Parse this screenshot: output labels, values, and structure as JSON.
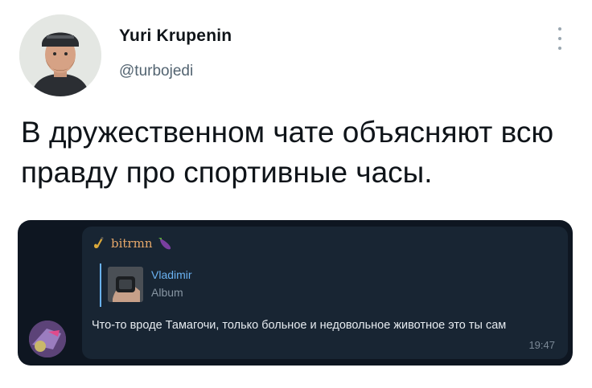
{
  "tweet": {
    "author": {
      "display_name": "Yuri Krupenin",
      "handle": "@turbojedi"
    },
    "text": "В дружественном чате объясняют всю правду про спортивные часы.",
    "more_icon": "more-vertical-icon"
  },
  "chat_screenshot": {
    "sender": {
      "name": "bitrmn",
      "left_emoji": "saxophone-icon",
      "right_emoji": "eggplant-icon"
    },
    "reply": {
      "name": "Vladimir",
      "subtitle": "Album"
    },
    "message": "Что-то вроде Тамагочи, только больное и недовольное животное это ты сам",
    "time": "19:47"
  },
  "colors": {
    "chat_background": "#0e1621",
    "bubble": "#182533",
    "sender_name": "#e6a86a",
    "reply_accent": "#6ab2f2"
  }
}
